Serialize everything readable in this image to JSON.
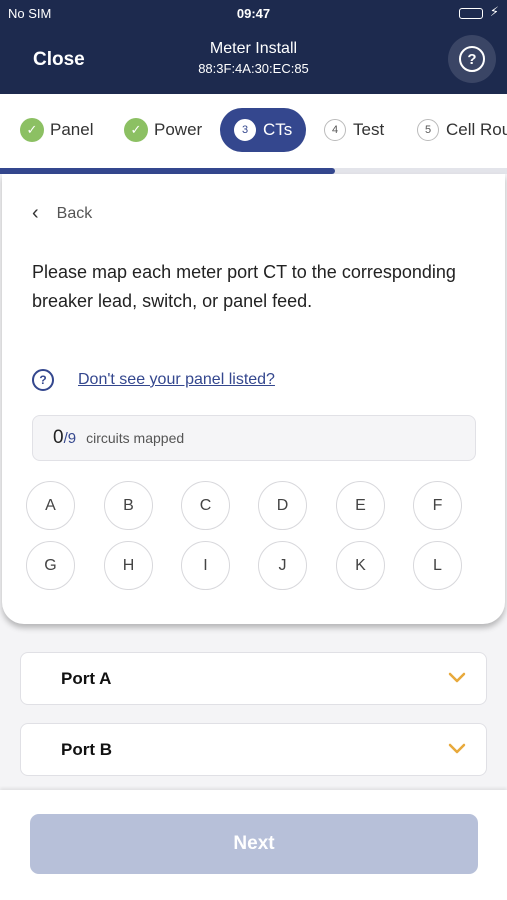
{
  "status_bar": {
    "carrier": "No SIM",
    "time": "09:47",
    "charge_symbol": "⚡",
    "battery_color": "#3ad15a"
  },
  "nav": {
    "close_label": "Close",
    "title": "Meter Install",
    "subtitle": "88:3F:4A:30:EC:85",
    "help_symbol": "?"
  },
  "steps": [
    {
      "label": "Panel",
      "state": "complete",
      "marker": "✓"
    },
    {
      "label": "Power",
      "state": "complete",
      "marker": "✓"
    },
    {
      "label": "CTs",
      "state": "active",
      "marker": "3"
    },
    {
      "label": "Test",
      "state": "pending",
      "marker": "4"
    },
    {
      "label": "Cell Rou",
      "state": "pending",
      "marker": "5"
    }
  ],
  "progress": {
    "fraction": 0.66
  },
  "card": {
    "back_label": "Back",
    "instruction": "Please map each meter port CT to the corresponding breaker lead, switch, or panel feed.",
    "help_link": "Don't see your panel listed?",
    "mapped_count": "0",
    "mapped_total": "/9",
    "mapped_label": "circuits mapped",
    "circuits": [
      "A",
      "B",
      "C",
      "D",
      "E",
      "F",
      "G",
      "H",
      "I",
      "J",
      "K",
      "L"
    ]
  },
  "ports": [
    {
      "label": "Port A"
    },
    {
      "label": "Port B"
    }
  ],
  "footer": {
    "next_label": "Next"
  },
  "colors": {
    "navy": "#1d2a4e",
    "accent": "#34478e",
    "check_green": "#8cc063",
    "chevron_orange": "#e8a93b",
    "disabled_button": "#b7c0d9"
  }
}
